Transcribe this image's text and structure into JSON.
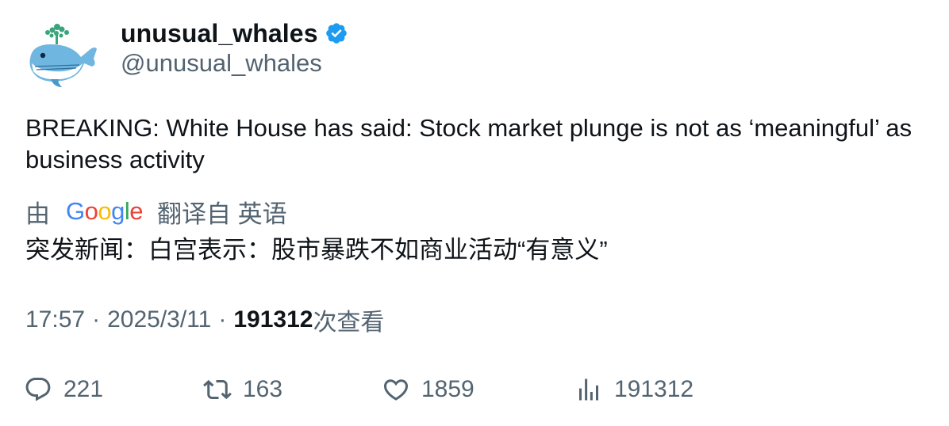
{
  "author": {
    "display_name": "unusual_whales",
    "handle": "@unusual_whales",
    "avatar_icon": "whale-avatar-icon",
    "verified_icon": "verified-badge-icon",
    "verified_color": "#1d9bf0"
  },
  "tweet": {
    "text": "BREAKING: White House has said: Stock market plunge is not as ‘meaningful’ as business activity"
  },
  "translation": {
    "prefix": "由",
    "provider": "Google",
    "suffix": "翻译自 英语",
    "text": "突发新闻：白宫表示：股市暴跌不如商业活动“有意义”"
  },
  "meta": {
    "time": "17:57",
    "separator": "·",
    "date": "2025/3/11",
    "views_count": "191312",
    "views_label": "次查看"
  },
  "actions": {
    "replies": "221",
    "retweets": "163",
    "likes": "1859",
    "views": "191312"
  },
  "colors": {
    "text_primary": "#0f1419",
    "text_secondary": "#536471",
    "verified": "#1d9bf0"
  }
}
